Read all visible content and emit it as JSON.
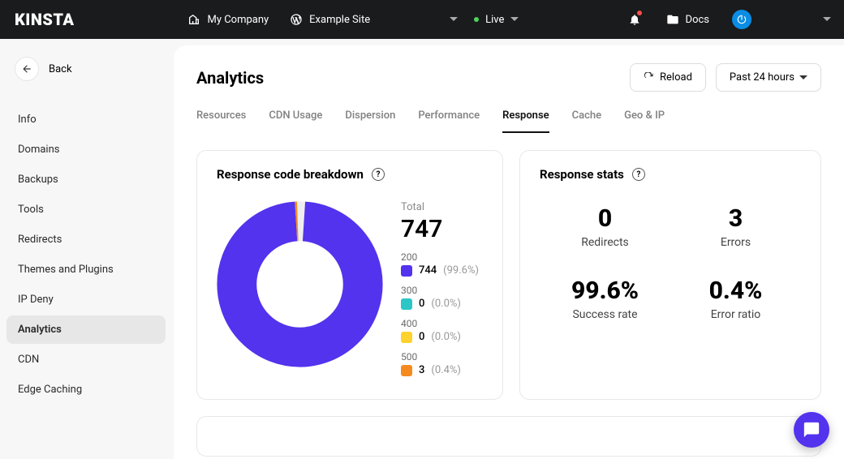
{
  "topbar": {
    "logo": "KINSTA",
    "company": "My Company",
    "site": "Example Site",
    "env": "Live",
    "docs": "Docs"
  },
  "sidebar": {
    "back": "Back",
    "items": [
      "Info",
      "Domains",
      "Backups",
      "Tools",
      "Redirects",
      "Themes and Plugins",
      "IP Deny",
      "Analytics",
      "CDN",
      "Edge Caching"
    ]
  },
  "page": {
    "title": "Analytics",
    "reload": "Reload",
    "filter": "Past 24 hours"
  },
  "tabs": [
    "Resources",
    "CDN Usage",
    "Dispersion",
    "Performance",
    "Response",
    "Cache",
    "Geo & IP"
  ],
  "breakdown": {
    "title": "Response code breakdown",
    "total_label": "Total",
    "total": "747",
    "legend": {
      "200": {
        "code": "200",
        "value": "744",
        "pct": "(99.6%)",
        "color": "#5333ed"
      },
      "300": {
        "code": "300",
        "value": "0",
        "pct": "(0.0%)",
        "color": "#2cc6c6"
      },
      "400": {
        "code": "400",
        "value": "0",
        "pct": "(0.0%)",
        "color": "#ffd22e"
      },
      "500": {
        "code": "500",
        "value": "3",
        "pct": "(0.4%)",
        "color": "#f58b1f"
      }
    }
  },
  "stats": {
    "title": "Response stats",
    "redirects": {
      "value": "0",
      "label": "Redirects"
    },
    "errors": {
      "value": "3",
      "label": "Errors"
    },
    "success": {
      "value": "99.6%",
      "label": "Success rate"
    },
    "error_ratio": {
      "value": "0.4%",
      "label": "Error ratio"
    }
  },
  "chart_data": {
    "type": "pie",
    "title": "Response code breakdown",
    "categories": [
      "200",
      "300",
      "400",
      "500"
    ],
    "values": [
      744,
      0,
      0,
      3
    ],
    "colors": [
      "#5333ed",
      "#2cc6c6",
      "#ffd22e",
      "#f58b1f"
    ],
    "total": 747
  }
}
